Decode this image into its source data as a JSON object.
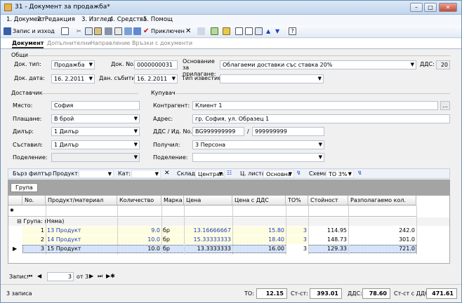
{
  "window": {
    "title": "31 - Документ за продажба*"
  },
  "menu": [
    "1. Документ",
    "2. Редакция",
    "3. Изглед",
    "4. Средства",
    "5. Помощ"
  ],
  "toolbar": {
    "save_close": "Запис и изход",
    "post": "Приключен"
  },
  "tabs": [
    "Документ",
    "Допълнителни",
    "Направление",
    "Връзки с документи"
  ],
  "general": {
    "heading": "Общи",
    "doc_type_label": "Док. тип:",
    "doc_type": "Продажба",
    "doc_no_label": "Док. No.",
    "doc_no": "0000000031",
    "basis_label": "Основание за прилагане:",
    "basis": "Облагаеми доставки със ставка 20%",
    "vat_label": "ДДС:",
    "vat": "20",
    "doc_date_label": "Док. дата:",
    "doc_date": "16. 2.2011",
    "event_date_label": "Дан. събитие:",
    "event_date": "16. 2.2011",
    "notice_label": "Тип известие:"
  },
  "supplier": {
    "heading": "Доставчик",
    "place_label": "Място:",
    "place": "София",
    "payment_label": "Плащане:",
    "payment": "В брой",
    "dealer_label": "Дилър:",
    "dealer": "1 Дилър",
    "author_label": "Съставил:",
    "author": "1 Дилър",
    "division_label": "Поделение:"
  },
  "buyer": {
    "heading": "Купувач",
    "contractor_label": "Контрагент:",
    "contractor": "Клиент 1",
    "address_label": "Адрес:",
    "address": "гр. София, ул. Образец 1",
    "vat_id_label": "ДДС / Ид. No.",
    "vat_no": "BG999999999",
    "id_sep": "/",
    "id_no": "999999999",
    "received_label": "Получил:",
    "received": "3 Персона",
    "division_label": "Поделение:"
  },
  "filter": {
    "quick_filter": "Бърз филтър",
    "product_label": "Продукт:",
    "cat_label": "Кат:",
    "store_label": "Склад",
    "store": "Централ",
    "price_list_label": "Ц. листа",
    "price_list": "Основна",
    "scheme_label": "Схема",
    "scheme": "ТО 3%"
  },
  "grid": {
    "group_button": "Група",
    "columns": [
      "No.",
      "Продукт/материал",
      "Количество",
      "Марка",
      "Цена",
      "Цена с ДДС",
      "ТО%",
      "Стойност",
      "Разполагаемо кол."
    ],
    "group_row": "Група: (Няма)",
    "rows": [
      {
        "no": "1",
        "product": "13 Продукт",
        "qty": "9.0",
        "unit": "бр",
        "price": "13.16666667",
        "price_vat": "15.80",
        "to": "3",
        "value": "114.95",
        "avail": "242.0"
      },
      {
        "no": "2",
        "product": "14 Продукт",
        "qty": "10.0",
        "unit": "бр",
        "price": "15.33333333",
        "price_vat": "18.40",
        "to": "3",
        "value": "148.73",
        "avail": "301.0"
      },
      {
        "no": "3",
        "product": "15 Продукт",
        "qty": "10.0",
        "unit": "бр",
        "price": "13.3333333",
        "price_vat": "16.00",
        "to": "3",
        "value": "129.33",
        "avail": "721.0"
      }
    ]
  },
  "nav": {
    "record_label": "Запис:",
    "current": "3",
    "of_total": "от 3"
  },
  "status": {
    "records": "3 записа",
    "to_label": "ТО:",
    "to": "12.15",
    "cost_label": "Ст-ст:",
    "cost": "393.01",
    "vat_label": "ДДС:",
    "vat": "78.60",
    "total_label": "Ст-ст с ДДС:",
    "total": "471.61"
  }
}
